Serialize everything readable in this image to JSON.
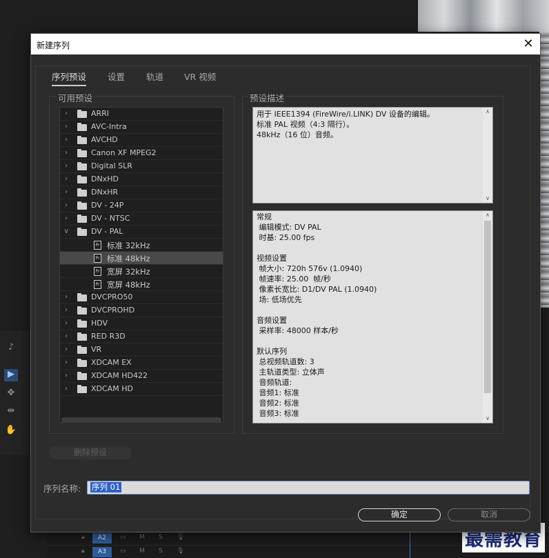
{
  "dialog": {
    "title": "新建序列",
    "close_glyph": "✕",
    "tabs": [
      {
        "label": "序列预设",
        "active": true
      },
      {
        "label": "设置",
        "active": false
      },
      {
        "label": "轨道",
        "active": false
      },
      {
        "label": "VR 视频",
        "active": false
      }
    ],
    "presets_label": "可用预设",
    "description_label": "预设描述",
    "tree": [
      {
        "type": "folder",
        "label": "ARRI",
        "expanded": false
      },
      {
        "type": "folder",
        "label": "AVC-Intra",
        "expanded": false
      },
      {
        "type": "folder",
        "label": "AVCHD",
        "expanded": false
      },
      {
        "type": "folder",
        "label": "Canon XF MPEG2",
        "expanded": false
      },
      {
        "type": "folder",
        "label": "Digital SLR",
        "expanded": false
      },
      {
        "type": "folder",
        "label": "DNxHD",
        "expanded": false
      },
      {
        "type": "folder",
        "label": "DNxHR",
        "expanded": false
      },
      {
        "type": "folder",
        "label": "DV - 24P",
        "expanded": false
      },
      {
        "type": "folder",
        "label": "DV - NTSC",
        "expanded": false
      },
      {
        "type": "folder",
        "label": "DV - PAL",
        "expanded": true
      },
      {
        "type": "file",
        "label": "标准 32kHz",
        "selected": false
      },
      {
        "type": "file",
        "label": "标准 48kHz",
        "selected": true
      },
      {
        "type": "file",
        "label": "宽屏 32kHz",
        "selected": false
      },
      {
        "type": "file",
        "label": "宽屏 48kHz",
        "selected": false
      },
      {
        "type": "folder",
        "label": "DVCPRO50",
        "expanded": false
      },
      {
        "type": "folder",
        "label": "DVCPROHD",
        "expanded": false
      },
      {
        "type": "folder",
        "label": "HDV",
        "expanded": false
      },
      {
        "type": "folder",
        "label": "RED R3D",
        "expanded": false
      },
      {
        "type": "folder",
        "label": "VR",
        "expanded": false
      },
      {
        "type": "folder",
        "label": "XDCAM EX",
        "expanded": false
      },
      {
        "type": "folder",
        "label": "XDCAM HD422",
        "expanded": false
      },
      {
        "type": "folder",
        "label": "XDCAM HD",
        "expanded": false
      }
    ],
    "file_icon_text": "Pr",
    "description": [
      "用于 IEEE1394 (FireWire/i.LINK) DV 设备的编辑。",
      "标准 PAL 视频（4:3 隔行）。",
      "48kHz（16 位）音频。"
    ],
    "info": [
      "常规",
      " 编辑模式: DV PAL",
      " 时基: 25.00 fps",
      "",
      "视频设置",
      " 帧大小: 720h 576v (1.0940)",
      " 帧速率: 25.00  帧/秒",
      " 像素长宽比: D1/DV PAL (1.0940)",
      " 场: 低场优先",
      "",
      "音频设置",
      " 采样率: 48000 样本/秒",
      "",
      "默认序列",
      " 总视频轨道数: 3",
      " 主轨道类型: 立体声",
      " 音频轨道:",
      " 音频1: 标准",
      " 音频2: 标准",
      " 音频3: 标准"
    ],
    "delete_preset_label": "删除预设",
    "sequence_name_label": "序列名称:",
    "sequence_name_value": "序列 01",
    "ok_label": "确定",
    "cancel_label": "取消"
  },
  "background": {
    "tracks": [
      {
        "name": "A2",
        "m": "M",
        "s": "S"
      },
      {
        "name": "A3",
        "m": "M",
        "s": "S"
      }
    ],
    "watermark": "最需教育"
  },
  "colors": {
    "accent_selection": "#2d5fc8",
    "dialog_bg": "#2c2c2c",
    "track_badge": "#2f5d9a"
  }
}
